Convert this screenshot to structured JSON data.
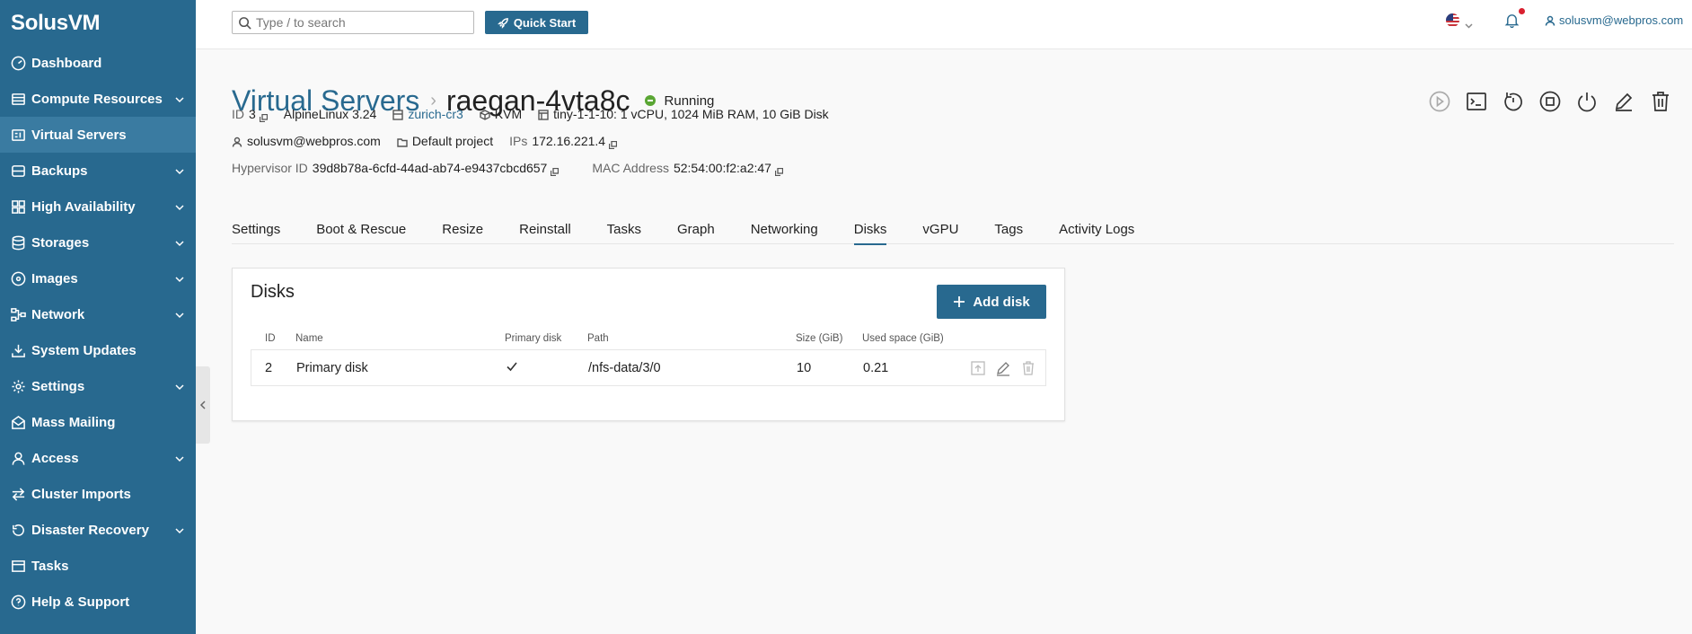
{
  "app": {
    "name": "SolusVM"
  },
  "sidebar": {
    "items": [
      {
        "label": "Dashboard",
        "icon": "speedometer-icon",
        "chevron": false,
        "active": false
      },
      {
        "label": "Compute Resources",
        "icon": "server-icon",
        "chevron": true,
        "active": false
      },
      {
        "label": "Virtual Servers",
        "icon": "virtual-server-icon",
        "chevron": false,
        "active": true
      },
      {
        "label": "Backups",
        "icon": "backup-icon",
        "chevron": true,
        "active": false
      },
      {
        "label": "High Availability",
        "icon": "grid-icon",
        "chevron": true,
        "active": false
      },
      {
        "label": "Storages",
        "icon": "database-icon",
        "chevron": true,
        "active": false
      },
      {
        "label": "Images",
        "icon": "disc-icon",
        "chevron": true,
        "active": false
      },
      {
        "label": "Network",
        "icon": "network-icon",
        "chevron": true,
        "active": false
      },
      {
        "label": "System Updates",
        "icon": "download-icon",
        "chevron": false,
        "active": false
      },
      {
        "label": "Settings",
        "icon": "gear-icon",
        "chevron": true,
        "active": false
      },
      {
        "label": "Mass Mailing",
        "icon": "mail-icon",
        "chevron": false,
        "active": false
      },
      {
        "label": "Access",
        "icon": "user-icon",
        "chevron": true,
        "active": false
      },
      {
        "label": "Cluster Imports",
        "icon": "transfer-icon",
        "chevron": false,
        "active": false
      },
      {
        "label": "Disaster Recovery",
        "icon": "recovery-icon",
        "chevron": true,
        "active": false
      },
      {
        "label": "Tasks",
        "icon": "tasks-icon",
        "chevron": false,
        "active": false
      },
      {
        "label": "Help & Support",
        "icon": "help-icon",
        "chevron": false,
        "active": false
      }
    ]
  },
  "header": {
    "search_placeholder": "Type / to search",
    "quick_start_label": "Quick Start",
    "user_email": "solusvm@webpros.com"
  },
  "server": {
    "breadcrumb": "Virtual Servers",
    "name": "raegan-4vta8c",
    "status": "Running",
    "id_label": "ID",
    "id": "3",
    "os": "AlpineLinux 3.24",
    "location": "zurich-cr3",
    "virtualization": "KVM",
    "plan": "tiny-1-1-10: 1 vCPU, 1024 MiB RAM, 10 GiB Disk",
    "owner": "solusvm@webpros.com",
    "project": "Default project",
    "ips_label": "IPs",
    "ips": "172.16.221.4",
    "hypervisor_label": "Hypervisor ID",
    "hypervisor_id": "39d8b78a-6cfd-44ad-ab74-e9437cbcd657",
    "mac_label": "MAC Address",
    "mac": "52:54:00:f2:a2:47"
  },
  "actions": [
    "play-icon",
    "console-icon",
    "restart-icon",
    "stop-icon",
    "power-icon",
    "edit-icon",
    "delete-icon"
  ],
  "tabs": [
    "Settings",
    "Boot & Rescue",
    "Resize",
    "Reinstall",
    "Tasks",
    "Graph",
    "Networking",
    "Disks",
    "vGPU",
    "Tags",
    "Activity Logs"
  ],
  "active_tab": "Disks",
  "disks": {
    "title": "Disks",
    "add_label": "Add disk",
    "columns": {
      "id": "ID",
      "name": "Name",
      "primary": "Primary disk",
      "path": "Path",
      "size": "Size (GiB)",
      "used": "Used space (GiB)"
    },
    "rows": [
      {
        "id": "2",
        "name": "Primary disk",
        "primary": true,
        "path": "/nfs-data/3/0",
        "size": "10",
        "used": "0.21"
      }
    ]
  },
  "colors": {
    "brand": "#28698f",
    "status_running": "#5aa634",
    "notification": "#d9202f"
  }
}
